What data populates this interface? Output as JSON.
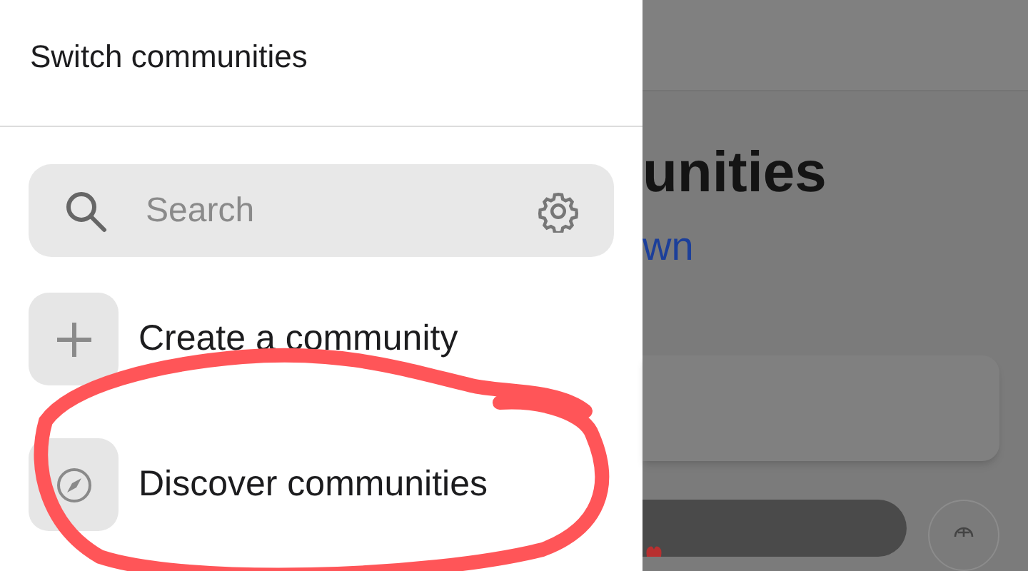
{
  "drawer": {
    "title": "Switch communities",
    "search": {
      "placeholder": "Search"
    },
    "items": [
      {
        "kind": "create",
        "label": "Create a community"
      },
      {
        "kind": "discover",
        "label": "Discover communities"
      }
    ]
  },
  "background": {
    "heading": "unities",
    "link": "wn"
  }
}
